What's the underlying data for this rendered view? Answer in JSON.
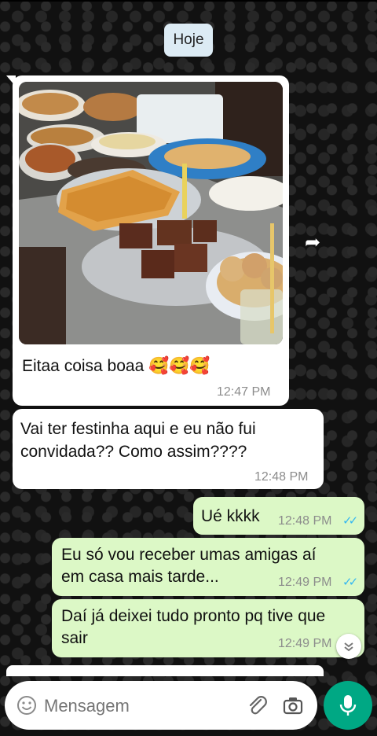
{
  "date_chip": "Hoje",
  "messages": [
    {
      "text": "Eitaa coisa boaa 🥰🥰🥰",
      "time": "12:47 PM"
    },
    {
      "line1": "Vai ter festinha aqui e eu não fui",
      "line2": "convidada?? Como assim????",
      "time": "12:48 PM"
    },
    {
      "text": "Ué kkkk",
      "time": "12:48 PM",
      "status": "read"
    },
    {
      "line1": "Eu só vou receber umas amigas aí",
      "line2": "em casa mais tarde...",
      "time": "12:49 PM",
      "status": "read"
    },
    {
      "line1": "Daí já deixei tudo pronto pq tive que",
      "line2": "sair",
      "time": "12:49 PM"
    }
  ],
  "icons": {
    "forward": "forward-icon",
    "scroll_down": "chevron-down-icon",
    "emoji": "emoji-icon",
    "attach": "paperclip-icon",
    "camera": "camera-icon",
    "mic": "mic-icon"
  },
  "input": {
    "placeholder": "Mensagem"
  },
  "colors": {
    "incoming": "#ffffff",
    "outgoing": "#dcf8c6",
    "accent": "#00a884",
    "read_ticks": "#34b7f1"
  }
}
